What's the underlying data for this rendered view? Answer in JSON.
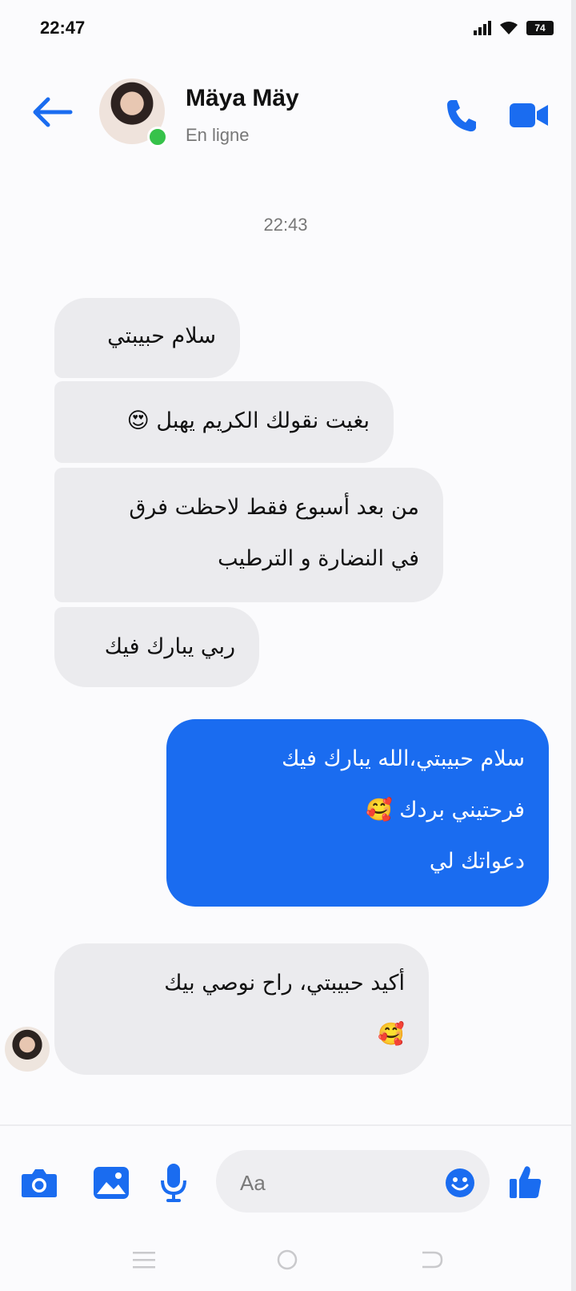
{
  "status_bar": {
    "time": "22:47",
    "battery_label": "74"
  },
  "contact": {
    "name": "Mäya Mäy",
    "presence": "En ligne"
  },
  "thread": {
    "timestamp": "22:43",
    "messages": [
      {
        "direction": "incoming",
        "lines": [
          "سلام حبيبتي"
        ]
      },
      {
        "direction": "incoming",
        "lines": [
          "بغيت نقولك الكريم يهبل 😍"
        ]
      },
      {
        "direction": "incoming",
        "lines": [
          "من بعد أسبوع فقط لاحظت فرق",
          "في النضارة و الترطيب"
        ]
      },
      {
        "direction": "incoming",
        "lines": [
          "ربي يبارك فيك"
        ]
      },
      {
        "direction": "outgoing",
        "lines": [
          "سلام حبيبتي،الله يبارك فيك",
          "فرحتيني بردك 🥰",
          "دعواتك لي"
        ]
      },
      {
        "direction": "incoming",
        "lines": [
          "أكيد حبيبتي، راح نوصي بيك",
          "🥰"
        ]
      }
    ]
  },
  "composer": {
    "placeholder": "Aa"
  },
  "icons": {
    "back": "arrow-left-icon",
    "call": "phone-icon",
    "video": "video-camera-icon",
    "camera": "camera-icon",
    "gallery": "image-icon",
    "mic": "microphone-icon",
    "emoji": "smiley-icon",
    "like": "thumbs-up-icon"
  },
  "colors": {
    "accent": "#1a6cf0",
    "incoming_bubble": "#ebebee",
    "online": "#36c24a"
  }
}
